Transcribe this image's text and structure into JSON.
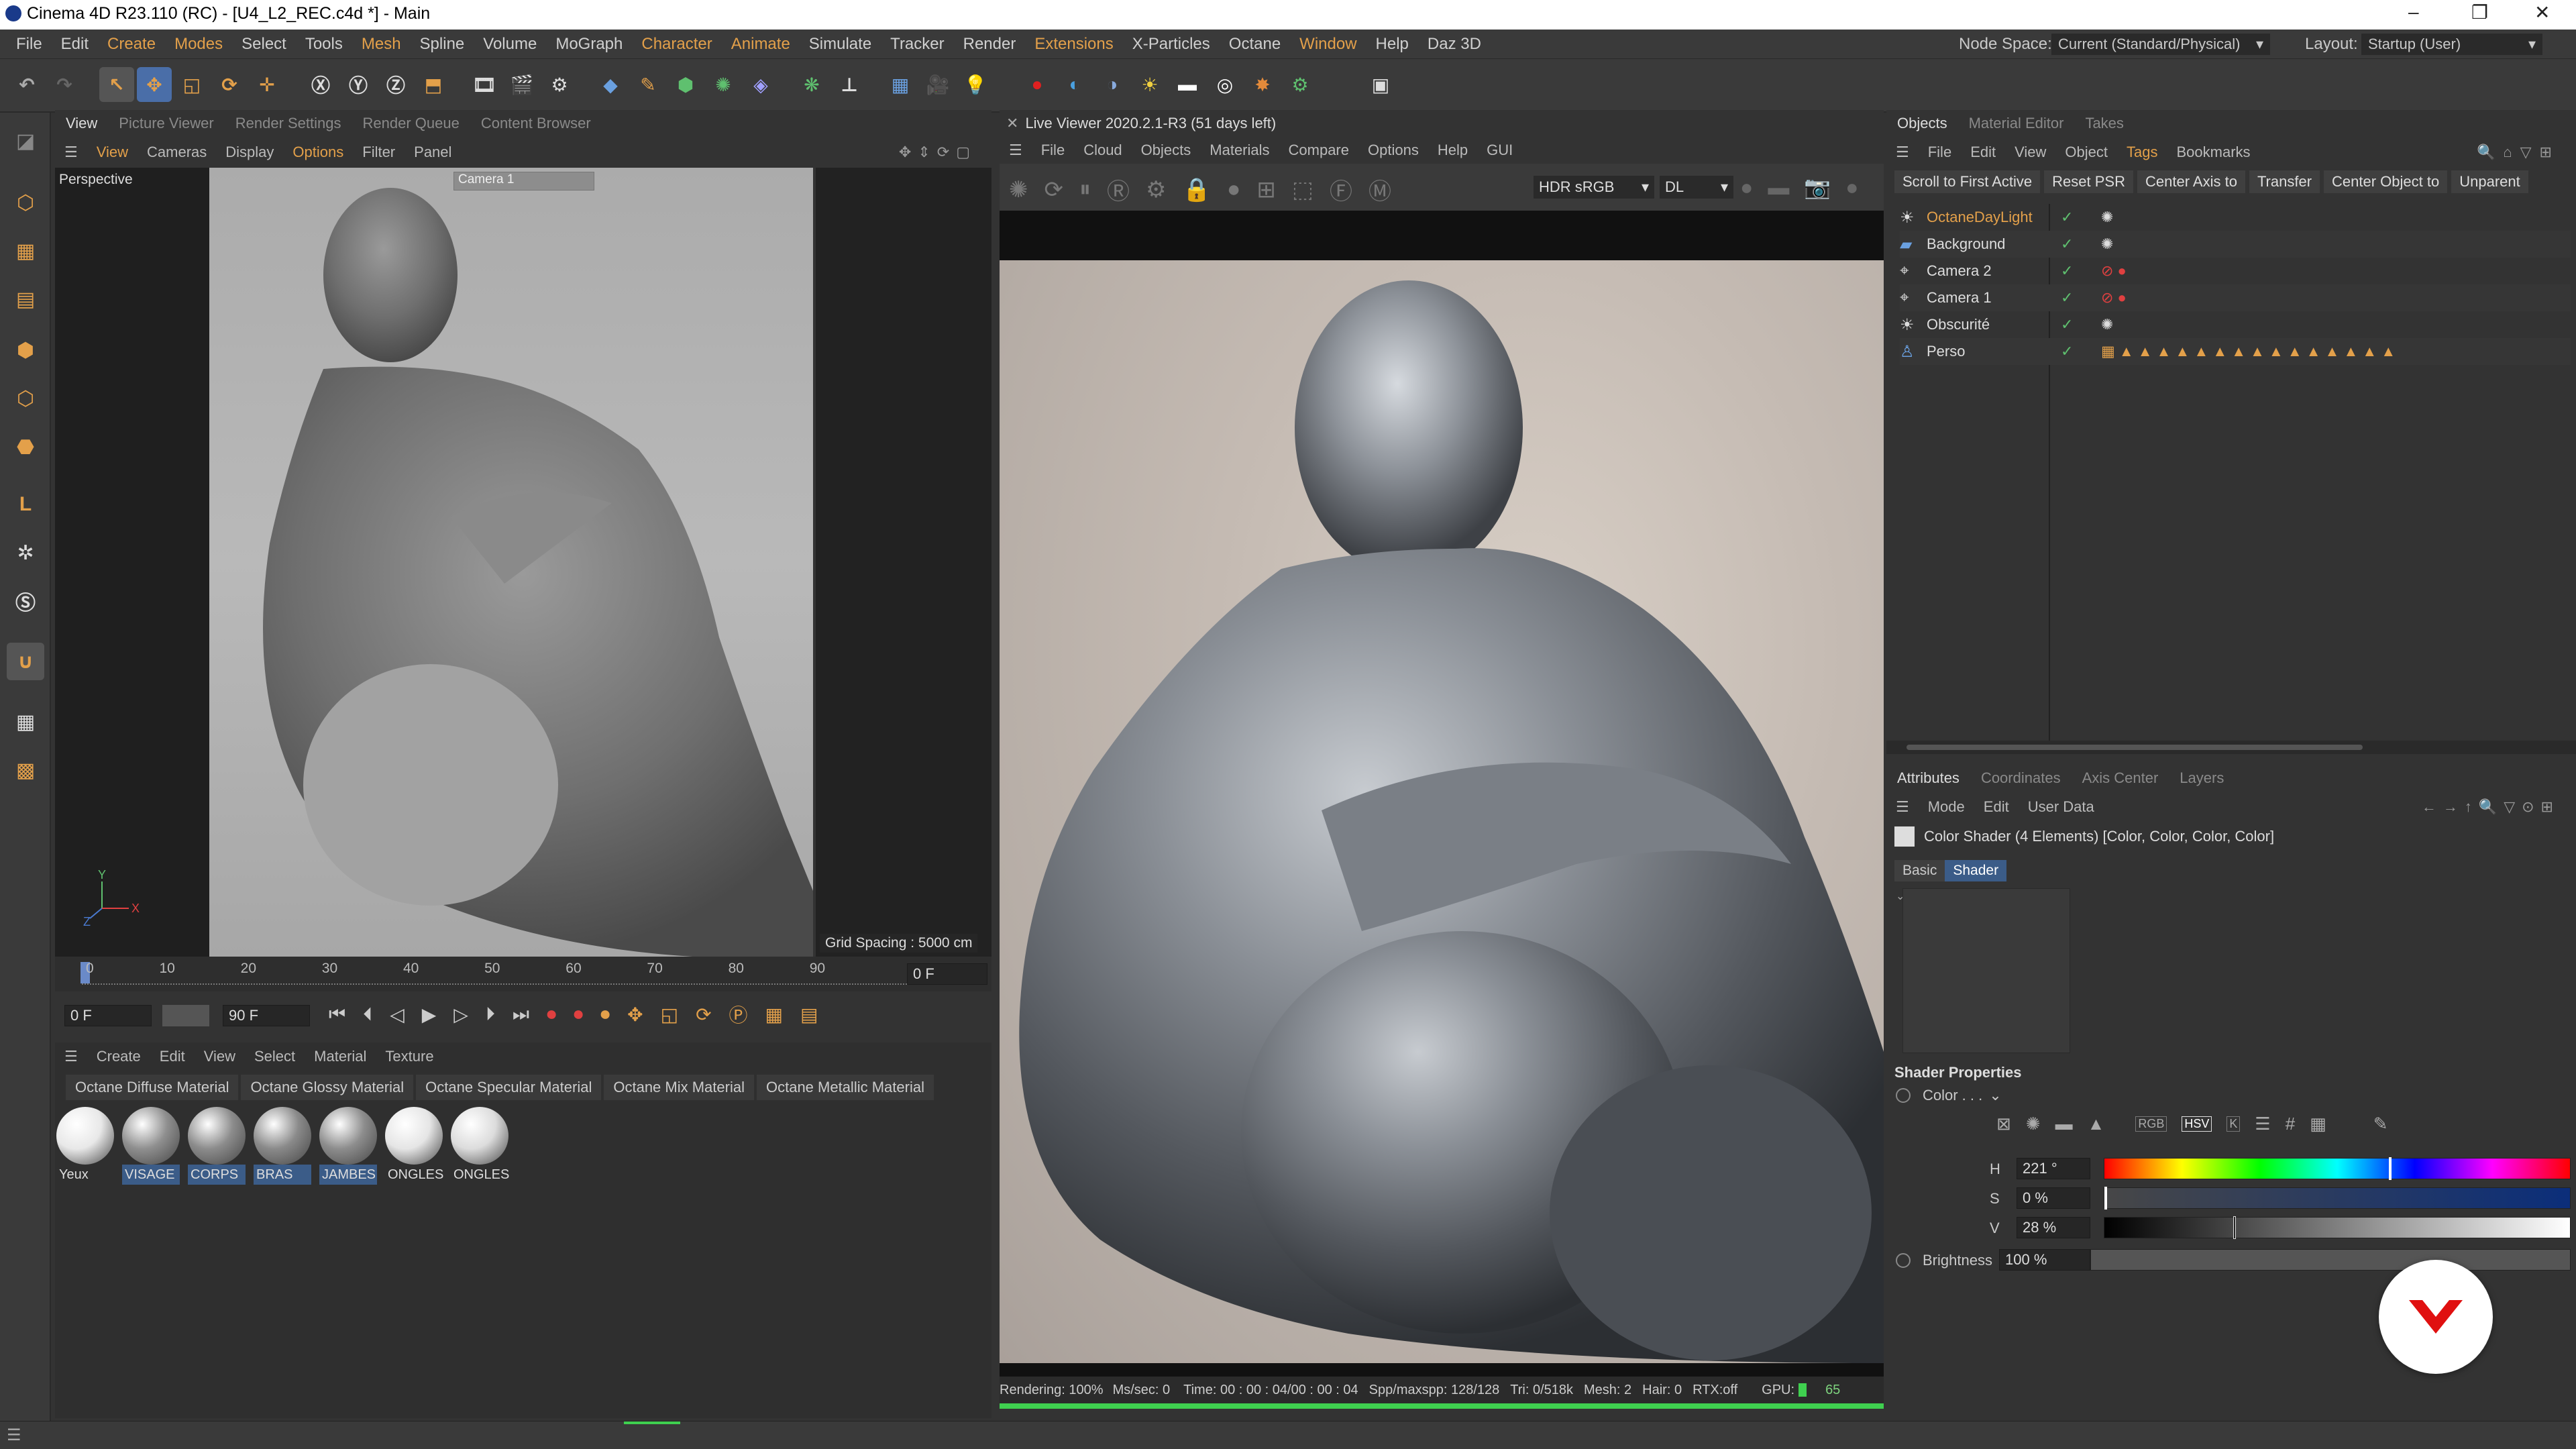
{
  "window": {
    "title": "Cinema 4D R23.110 (RC) - [U4_L2_REC.c4d *] - Main",
    "minimize": "–",
    "maximize": "❐",
    "close": "✕"
  },
  "menubar": {
    "items": [
      "File",
      "Edit",
      "Create",
      "Modes",
      "Select",
      "Tools",
      "Mesh",
      "Spline",
      "Volume",
      "MoGraph",
      "Character",
      "Animate",
      "Simulate",
      "Tracker",
      "Render",
      "Extensions",
      "X-Particles",
      "Octane",
      "Window",
      "Help",
      "Daz 3D"
    ],
    "node_space_label": "Node Space:",
    "node_space_value": "Current (Standard/Physical)",
    "layout_label": "Layout:",
    "layout_value": "Startup (User)"
  },
  "viewport_panel": {
    "tabs": [
      "View",
      "Picture Viewer",
      "Render Settings",
      "Render Queue",
      "Content Browser"
    ],
    "menu": [
      "View",
      "Cameras",
      "Display",
      "Options",
      "Filter",
      "Panel"
    ],
    "label": "Perspective",
    "camera_label": "Camera 1",
    "grid_spacing": "Grid Spacing : 5000 cm",
    "axis_y": "Y",
    "axis_x": "X",
    "axis_z": "Z"
  },
  "timeline": {
    "ticks": [
      "0",
      "10",
      "20",
      "30",
      "40",
      "50",
      "60",
      "70",
      "80",
      "90"
    ],
    "current_frame_display": "0 F",
    "start_frame": "0 F",
    "end_frame": "90 F"
  },
  "material_manager": {
    "menu": [
      "Create",
      "Edit",
      "View",
      "Select",
      "Material",
      "Texture"
    ],
    "tabs": [
      "Octane Diffuse Material",
      "Octane Glossy Material",
      "Octane Specular Material",
      "Octane Mix Material",
      "Octane Metallic Material"
    ],
    "materials": [
      {
        "name": "Yeux",
        "selected": false,
        "color": "#e8e8e8"
      },
      {
        "name": "VISAGE",
        "selected": true,
        "color": "#8f8f8f"
      },
      {
        "name": "CORPS",
        "selected": true,
        "color": "#8c8c8c"
      },
      {
        "name": "BRAS",
        "selected": true,
        "color": "#8a8a8a"
      },
      {
        "name": "JAMBES",
        "selected": true,
        "color": "#8d8d8d"
      },
      {
        "name": "ONGLES",
        "selected": false,
        "color": "#e5e5e5"
      },
      {
        "name": "ONGLES",
        "selected": false,
        "color": "#dcdcdc"
      }
    ]
  },
  "live_viewer": {
    "title": "Live Viewer 2020.2.1-R3 (51 days left)",
    "menu": [
      "File",
      "Cloud",
      "Objects",
      "Materials",
      "Compare",
      "Options",
      "Help",
      "GUI"
    ],
    "color_space": "HDR sRGB",
    "mode": "DL",
    "status": {
      "rendering": "Rendering: 100%",
      "ms_sec": "Ms/sec: 0",
      "time": "Time: 00 : 00 : 04/00 : 00 : 04",
      "spp": "Spp/maxspp: 128/128",
      "tri": "Tri: 0/518k",
      "mesh": "Mesh: 2",
      "hair": "Hair: 0",
      "rtx": "RTX:off",
      "gpu": "GPU:",
      "gpu_val": "65"
    },
    "progress": 1.0
  },
  "object_manager": {
    "tabs": [
      "Objects",
      "Material Editor",
      "Takes"
    ],
    "menu": [
      "File",
      "Edit",
      "View",
      "Object",
      "Tags",
      "Bookmarks"
    ],
    "buttons": [
      "Scroll to First Active",
      "Reset PSR",
      "Center Axis to",
      "Transfer",
      "Center Object to",
      "Unparent"
    ],
    "objects": [
      {
        "name": "OctaneDayLight",
        "active": true
      },
      {
        "name": "Background",
        "active": false
      },
      {
        "name": "Camera 2",
        "active": false
      },
      {
        "name": "Camera 1",
        "active": false
      },
      {
        "name": "Obscurité",
        "active": false
      },
      {
        "name": "Perso",
        "active": false
      }
    ]
  },
  "attributes": {
    "tabs": [
      "Attributes",
      "Coordinates",
      "Axis Center",
      "Layers"
    ],
    "menu": [
      "Mode",
      "Edit",
      "User Data"
    ],
    "header": "Color Shader (4 Elements) [Color, Color, Color, Color]",
    "subtabs": [
      "Basic",
      "Shader"
    ],
    "section": "Shader Properties",
    "color_label": "Color . . .",
    "h_label": "H",
    "h_value": "221 °",
    "h_fraction": 0.614,
    "s_label": "S",
    "s_value": "0 %",
    "s_fraction": 0.0,
    "v_label": "V",
    "v_value": "28 %",
    "v_fraction": 0.28,
    "brightness_label": "Brightness",
    "brightness_value": "100 %",
    "brightness_fraction": 1.0,
    "mode_buttons": [
      "RGB",
      "HSV",
      "K"
    ]
  },
  "colors": {
    "accent": "#e3a04a",
    "selection_blue": "#3b5c88",
    "progress_green": "#3fd04f"
  }
}
